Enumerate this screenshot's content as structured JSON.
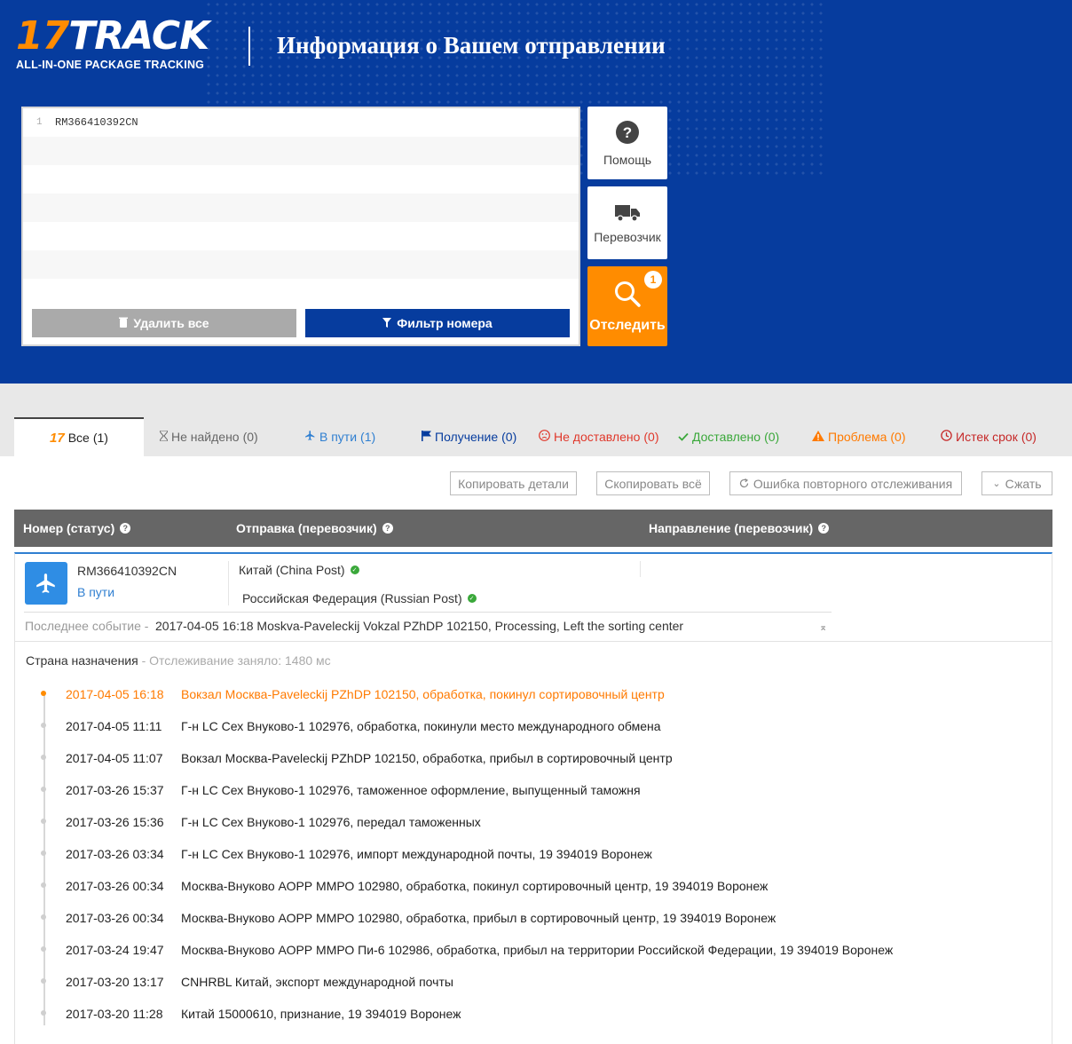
{
  "header": {
    "logo_num": "17",
    "logo_word": "TRACK",
    "logo_tagline": "ALL-IN-ONE PACKAGE TRACKING",
    "title": "Информация о Вашем отправлении"
  },
  "input": {
    "lines": [
      {
        "num": "1",
        "text": "RM366410392CN"
      },
      {
        "num": "",
        "text": ""
      },
      {
        "num": "",
        "text": ""
      },
      {
        "num": "",
        "text": ""
      },
      {
        "num": "",
        "text": ""
      },
      {
        "num": "",
        "text": ""
      },
      {
        "num": "",
        "text": ""
      }
    ],
    "clear_label": "Удалить все",
    "filter_label": "Фильтр номера"
  },
  "side": {
    "help_label": "Помощь",
    "carrier_label": "Перевозчик",
    "track_label": "Отследить",
    "track_badge": "1"
  },
  "tabs": [
    {
      "label": "Все",
      "count": "(1)",
      "color": "#222222",
      "icon": "17-logo-icon"
    },
    {
      "label": "Не найдено",
      "count": "(0)",
      "color": "#666666",
      "icon": "hourglass-icon"
    },
    {
      "label": "В пути",
      "count": "(1)",
      "color": "#2f7fd1",
      "icon": "plane-icon"
    },
    {
      "label": "Получение",
      "count": "(0)",
      "color": "#063c9e",
      "icon": "flag-icon"
    },
    {
      "label": "Не доставлено",
      "count": "(0)",
      "color": "#e0382b",
      "icon": "sad-face-icon"
    },
    {
      "label": "Доставлено",
      "count": "(0)",
      "color": "#3aa83a",
      "icon": "check-icon"
    },
    {
      "label": "Проблема",
      "count": "(0)",
      "color": "#ff7a00",
      "icon": "warning-icon"
    },
    {
      "label": "Истек срок",
      "count": "(0)",
      "color": "#c62828",
      "icon": "clock-icon"
    }
  ],
  "toolbar": {
    "copy_details": "Копировать детали",
    "copy_all": "Скопировать всё",
    "retrack": "Ошибка повторного отслеживания",
    "collapse": "Сжать"
  },
  "table": {
    "col_number": "Номер (статус)",
    "col_origin": "Отправка (перевозчик)",
    "col_dest": "Направление (перевозчик)"
  },
  "shipment": {
    "number": "RM366410392CN",
    "status": "В пути",
    "origin": "Китай (China Post)",
    "destination": "Российская Федерация (Russian Post)",
    "last_event_label": "Последнее событие -",
    "last_event": "2017-04-05 16:18 Moskva-Paveleckij Vokzal PZhDP 102150, Processing, Left the sorting center",
    "dest_country_label": "Страна назначения",
    "tracking_time": "- Отслеживание заняло: 1480 мс",
    "events": [
      {
        "datetime": "2017-04-05 16:18",
        "desc": "Вокзал Москва-Paveleckij PZhDP 102150, обработка, покинул сортировочный центр"
      },
      {
        "datetime": "2017-04-05 11:11",
        "desc": "Г-н LC Сех Внуково-1 102976, обработка, покинули место международного обмена"
      },
      {
        "datetime": "2017-04-05 11:07",
        "desc": "Вокзал Москва-Paveleckij PZhDP 102150, обработка, прибыл в сортировочный центр"
      },
      {
        "datetime": "2017-03-26 15:37",
        "desc": "Г-н LC Сех Внуково-1 102976, таможенное оформление, выпущенный таможня"
      },
      {
        "datetime": "2017-03-26 15:36",
        "desc": "Г-н LC Сех Внуково-1 102976, передал таможенных"
      },
      {
        "datetime": "2017-03-26 03:34",
        "desc": "Г-н LC Сех Внуково-1 102976, импорт международной почты, 19 394019 Воронеж"
      },
      {
        "datetime": "2017-03-26 00:34",
        "desc": "Москва-Внуково АОРР ММРО 102980, обработка, покинул сортировочный центр, 19 394019 Воронеж"
      },
      {
        "datetime": "2017-03-26 00:34",
        "desc": "Москва-Внуково АОРР ММРО 102980, обработка, прибыл в сортировочный центр, 19 394019 Воронеж"
      },
      {
        "datetime": "2017-03-24 19:47",
        "desc": "Москва-Внуково АОРР ММРО Пи-6 102986, обработка, прибыл на территории Российской Федерации, 19 394019 Воронеж"
      },
      {
        "datetime": "2017-03-20 13:17",
        "desc": "CNHRBL Китай, экспорт международной почты"
      },
      {
        "datetime": "2017-03-20 11:28",
        "desc": "Китай 15000610, признание, 19 394019 Воронеж"
      }
    ]
  },
  "colors": {
    "brand_blue": "#063c9e",
    "accent_orange": "#ff8c00",
    "status_blue": "#2f7fd1"
  }
}
